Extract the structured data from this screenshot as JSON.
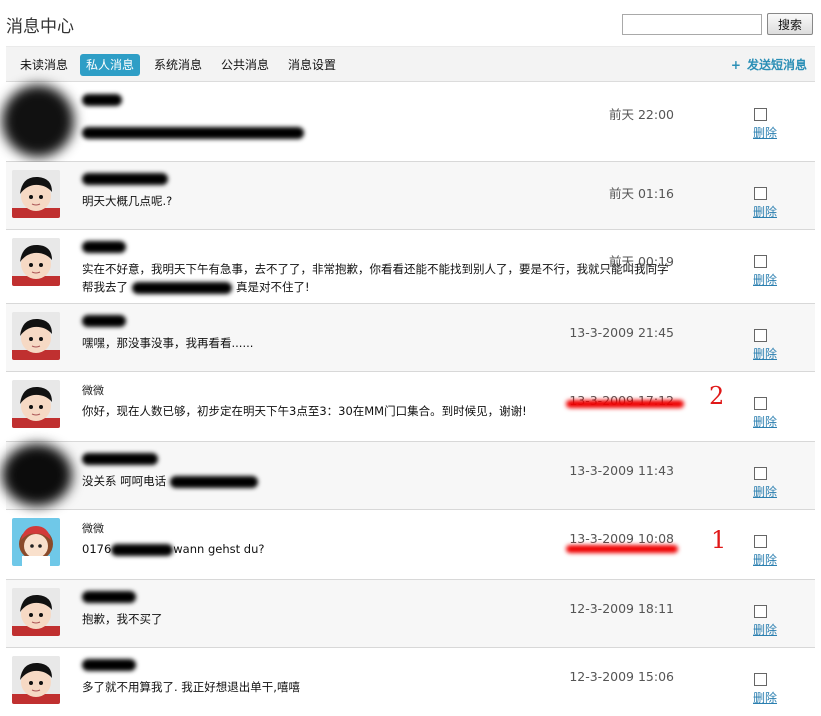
{
  "header": {
    "title": "消息中心",
    "search_button": "搜索",
    "search_value": ""
  },
  "tabs": [
    {
      "label": "未读消息",
      "active": false
    },
    {
      "label": "私人消息",
      "active": true
    },
    {
      "label": "系统消息",
      "active": false
    },
    {
      "label": "公共消息",
      "active": false
    },
    {
      "label": "消息设置",
      "active": false
    }
  ],
  "send_link": {
    "icon": "+",
    "label": "发送短消息"
  },
  "colors": {
    "active_tab": "#2e9ec6",
    "link": "#2b8fb6",
    "annotation": "#e01818"
  },
  "messages": [
    {
      "name": "",
      "text": "",
      "time": "前天 22:00",
      "delete": "删除"
    },
    {
      "name": "",
      "text": "明天大概几点呢.?",
      "time": "前天 01:16",
      "delete": "删除"
    },
    {
      "name": "",
      "text": "实在不好意，我明天下午有急事，去不了了，非常抱歉，你看看还能不能找到别人了，要是不行，我就只能叫我同学帮我去了",
      "text_tail": "真是对不住了!",
      "time": "前天 00:19",
      "delete": "删除"
    },
    {
      "name": "",
      "text": "嘿嘿，那没事没事，我再看看......",
      "time": "13-3-2009 21:45",
      "delete": "删除"
    },
    {
      "name": "微微",
      "text": "你好，现在人数已够，初步定在明天下午3点至3：30在MM门口集合。到时候见，谢谢!",
      "time": "13-3-2009 17:12",
      "delete": "删除"
    },
    {
      "name": "",
      "text": "没关系 呵呵电话",
      "time": "13-3-2009 11:43",
      "delete": "删除"
    },
    {
      "name": "微微",
      "text_prefix": "0176",
      "text": "wann gehst du?",
      "time": "13-3-2009 10:08",
      "delete": "删除"
    },
    {
      "name": "",
      "text": "抱歉，我不买了",
      "time": "12-3-2009 18:11",
      "delete": "删除"
    },
    {
      "name": "",
      "text": "多了就不用算我了. 我正好想退出单干,嘻嘻",
      "time": "12-3-2009 15:06",
      "delete": "删除"
    }
  ],
  "annotations": {
    "mark_1": "1",
    "mark_2": "2"
  }
}
